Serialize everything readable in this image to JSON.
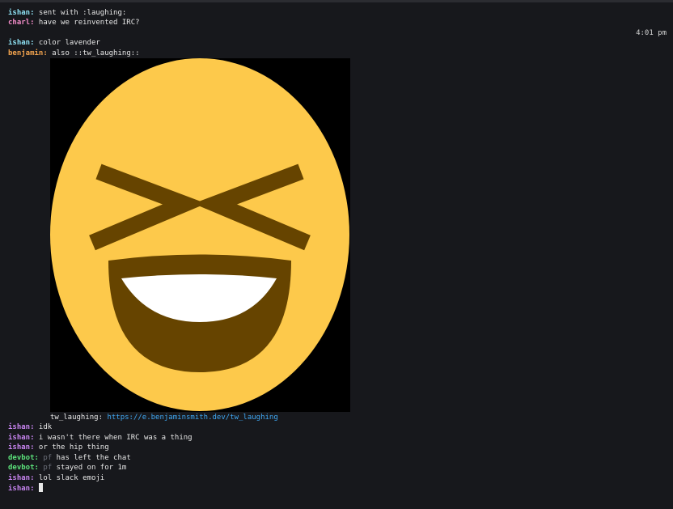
{
  "messages_top": [
    {
      "nick": "ishan",
      "text": " sent with :laughing:"
    },
    {
      "nick": "charl",
      "text": " have we reinvented IRC?"
    },
    {
      "nick": "ishan",
      "text": " color lavender"
    },
    {
      "nick": "benjamin",
      "text": " also ::tw_laughing::"
    }
  ],
  "timestamp": "4:01 pm",
  "emoji": {
    "name": "tw_laughing:",
    "url": "https://e.benjaminsmith.dev/tw_laughing",
    "icon": "grinning-squinting-face"
  },
  "messages_bottom": [
    {
      "nick": "ishan",
      "text": " idk"
    },
    {
      "nick": "ishan",
      "text": " i wasn't there when IRC was a thing"
    },
    {
      "nick": "ishan",
      "text": " or the hip thing"
    },
    {
      "nick": "devbot",
      "muted": "pf",
      "text": " has left the chat"
    },
    {
      "nick": "devbot",
      "muted": "pf",
      "text": " stayed on for 1m"
    },
    {
      "nick": "ishan",
      "text": " lol slack emoji"
    }
  ],
  "input": {
    "nick": "ishan",
    "value": ""
  },
  "colors": {
    "background": "#17181c",
    "nick_cyan": "#8fe3f5",
    "nick_pink": "#f28cc8",
    "nick_orange": "#f2a34e",
    "nick_purple": "#c985f2",
    "nick_green": "#5be07a",
    "link": "#3fa7f2"
  }
}
